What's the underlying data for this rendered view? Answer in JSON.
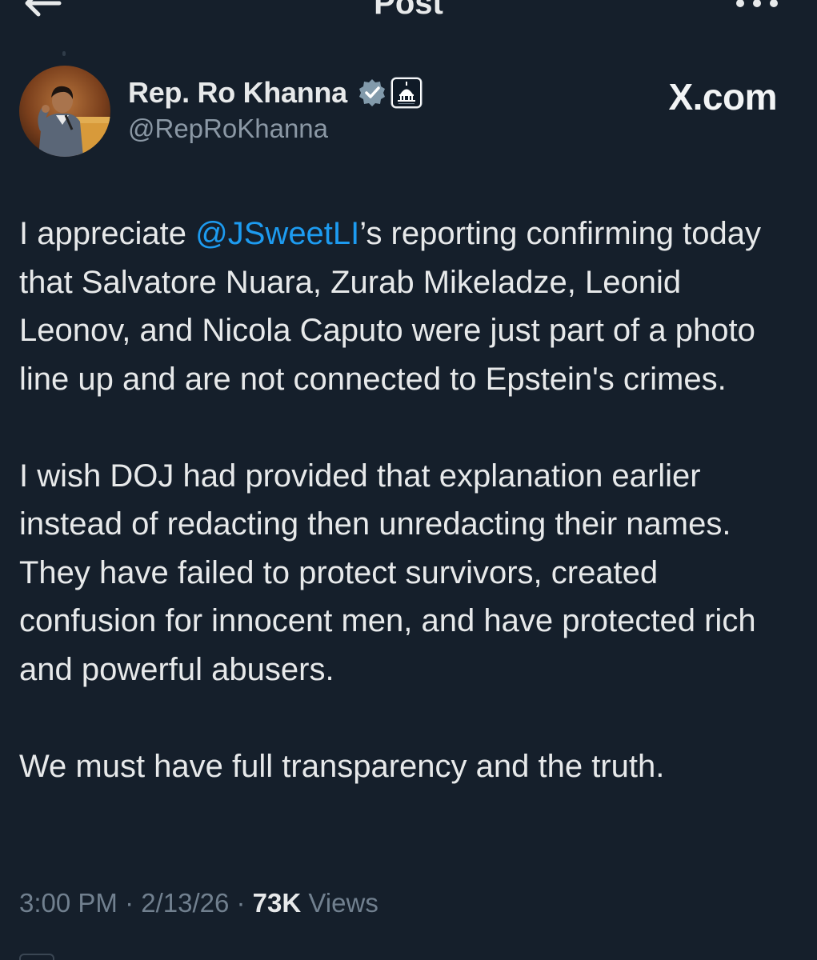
{
  "header": {
    "title": "Post"
  },
  "author": {
    "display_name": "Rep. Ro Khanna",
    "handle": "@RepRoKhanna",
    "verified_icon": "verified-badge-icon",
    "affiliation_icon": "capitol-icon"
  },
  "watermark": "X.com",
  "post": {
    "p1_before": "I appreciate ",
    "mention": "@JSweetLI",
    "p1_after": "’s reporting confirming today that Salvatore Nuara, Zurab Mikeladze, Leonid Leonov, and Nicola Caputo were just part of a photo line up and are not connected to Epstein's crimes.",
    "p2": "I wish DOJ had provided that explanation earlier instead of redacting then unredacting their names. They have failed to protect survivors, created confusion for innocent men, and have protected rich and powerful abusers.",
    "p3": "We must have full transparency and the truth."
  },
  "meta": {
    "time": "3:00 PM",
    "sep1": " · ",
    "date": "2/13/26",
    "sep2": " · ",
    "views_count": "73K",
    "views_label": " Views"
  },
  "colors": {
    "background": "#151f2b",
    "text": "#e7e9ea",
    "secondary": "#8b98a5",
    "link": "#1d9bf0"
  }
}
